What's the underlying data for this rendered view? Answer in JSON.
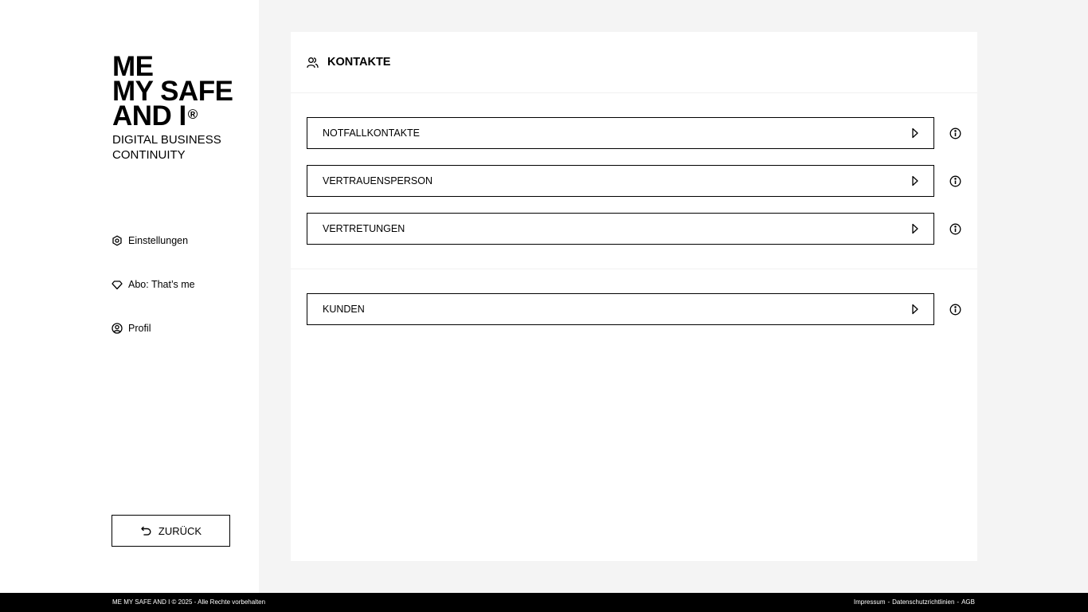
{
  "logo": {
    "line1": "ME",
    "line2": "MY SAFE",
    "line3": "AND I",
    "reg": "®",
    "tagline": "DIGITAL BUSINESS CONTINUITY"
  },
  "nav": {
    "items": [
      {
        "label": "Einstellungen",
        "icon": "settings-icon"
      },
      {
        "label": "Abo: That’s me",
        "icon": "diamond-icon"
      },
      {
        "label": "Profil",
        "icon": "user-circle-icon"
      }
    ]
  },
  "back_button": {
    "label": "ZURÜCK",
    "icon": "undo-icon"
  },
  "panel": {
    "title": "KONTAKTE",
    "icon": "users-icon",
    "groups": [
      {
        "items": [
          "NOTFALLKONTAKTE",
          "VERTRAUENSPERSON",
          "VERTRETUNGEN"
        ]
      },
      {
        "items": [
          "KUNDEN"
        ]
      }
    ]
  },
  "footer": {
    "copyright": "ME MY SAFE AND I © 2025 - Alle Rechte vorbehalten",
    "links": [
      "Impressum",
      "Datenschutzrichtlinien",
      "AGB"
    ],
    "separator": "-"
  },
  "colors": {
    "sidebar_bg": "#ffffff",
    "page_bg": "#f4f4f4",
    "footer_bg": "#000000",
    "border": "#000000"
  }
}
